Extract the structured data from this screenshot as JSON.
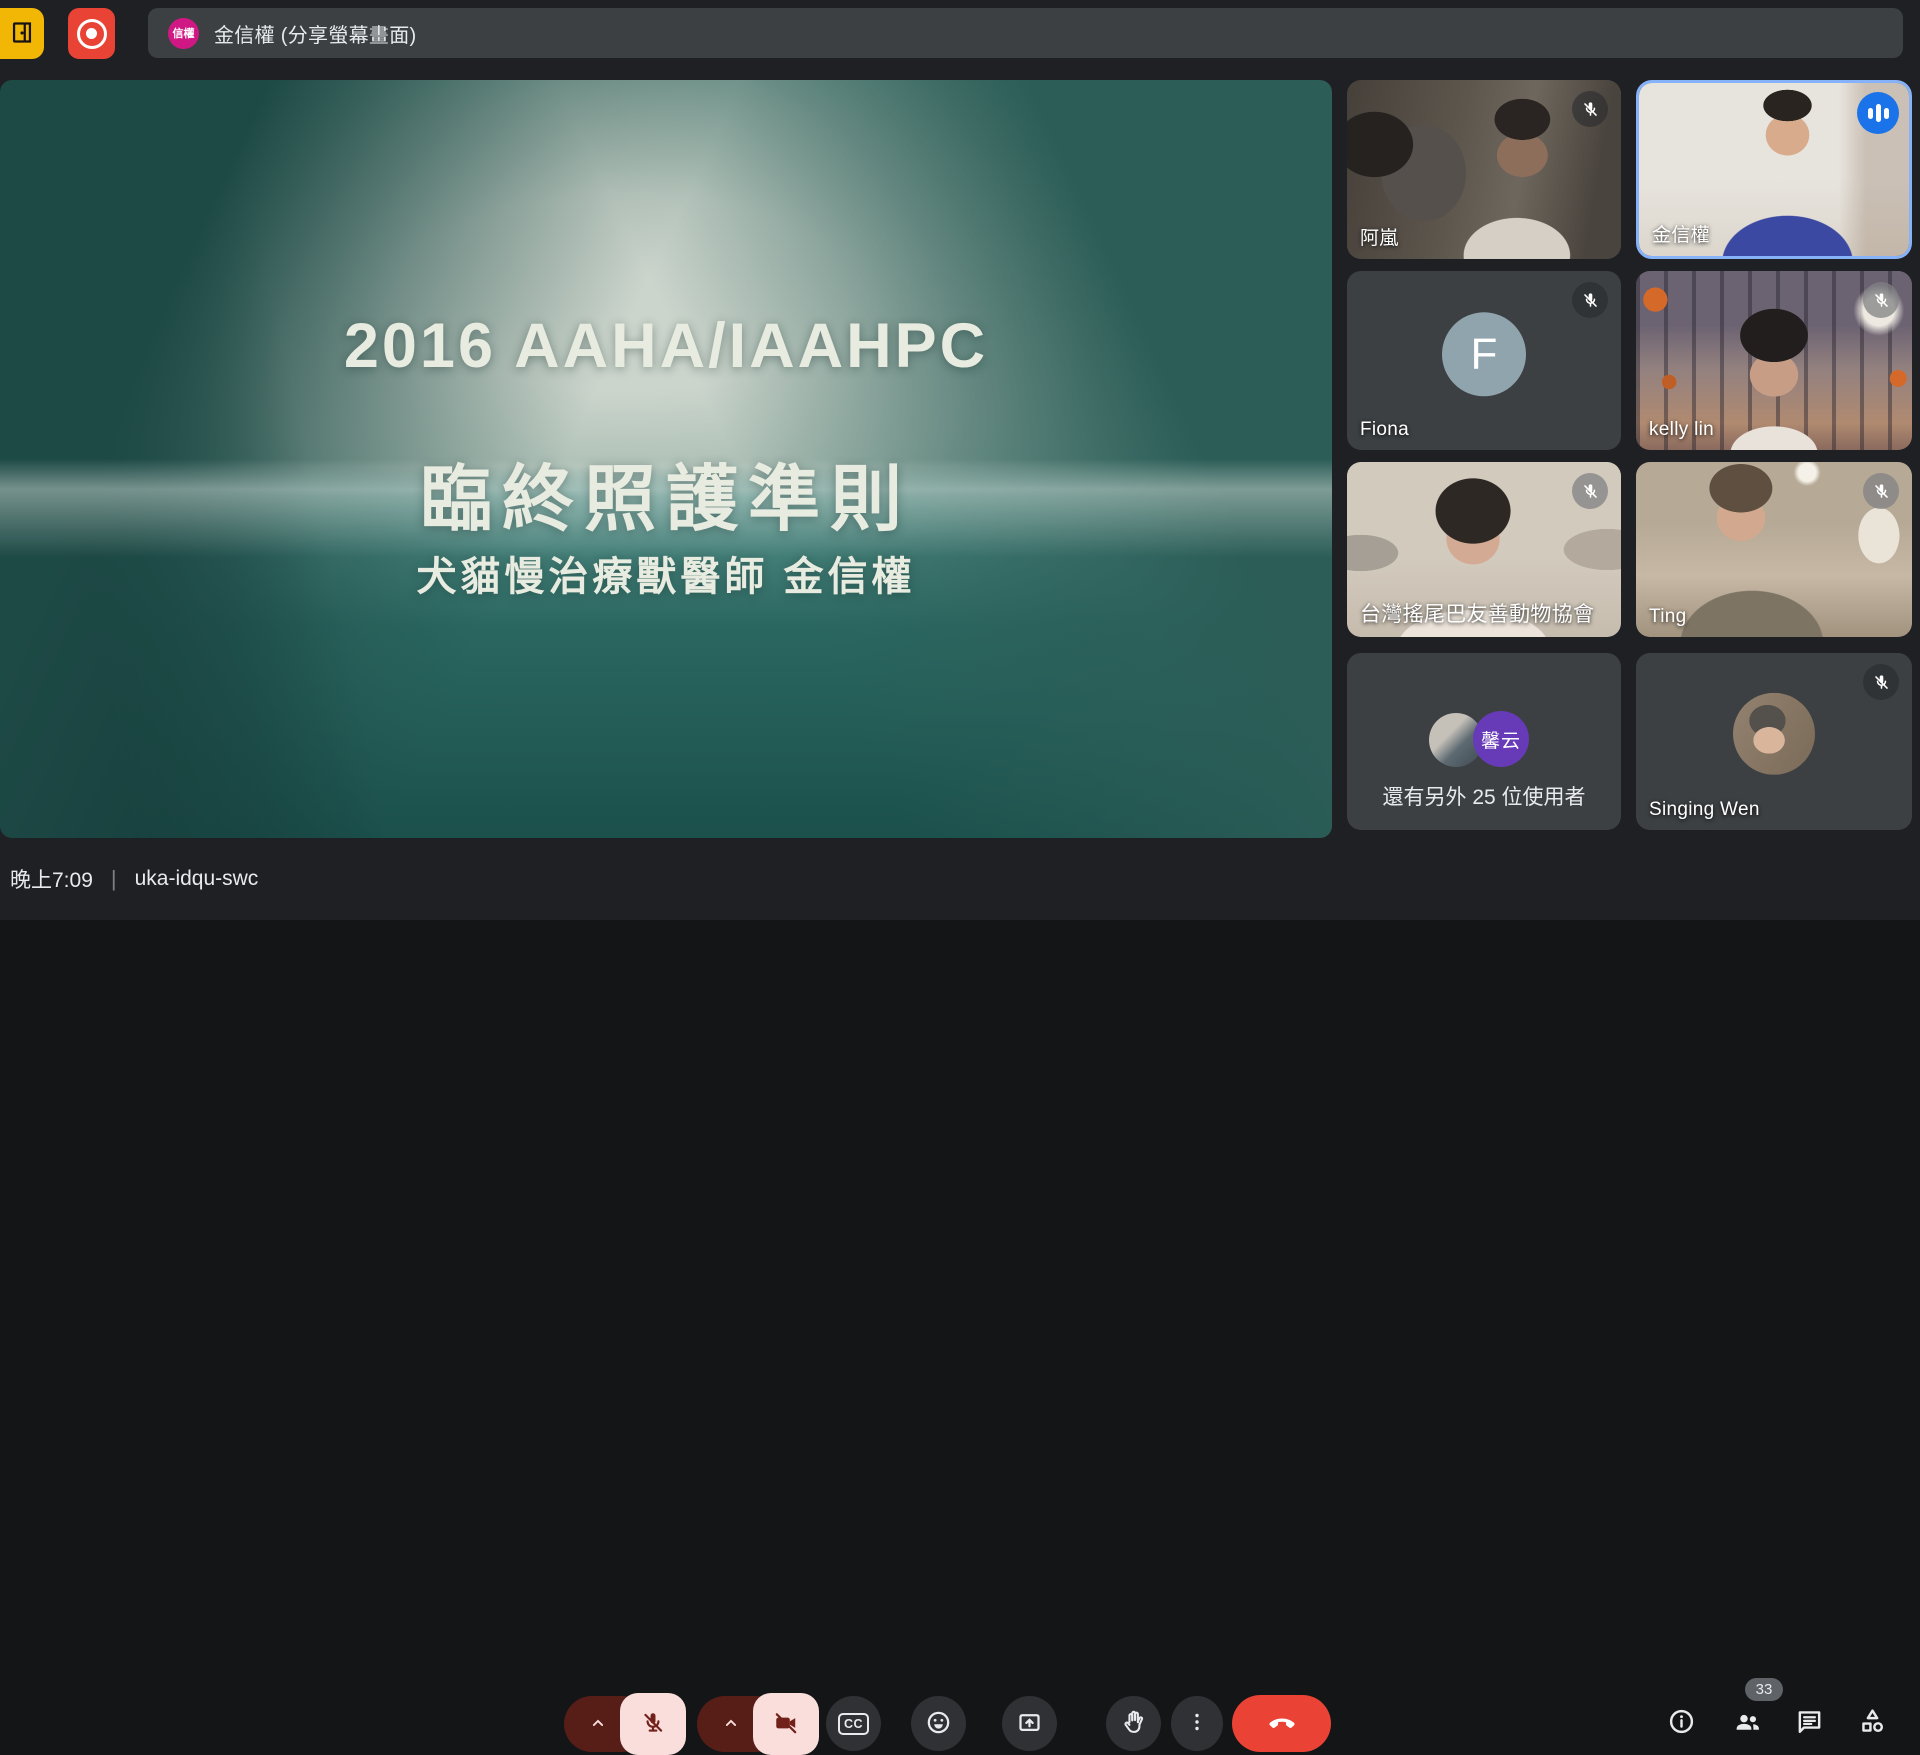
{
  "top_bar": {
    "presenter_chip": {
      "avatar": "信權",
      "title": "金信權 (分享螢幕畫面)"
    }
  },
  "slide": {
    "line1": "2016 AAHA/IAAHPC",
    "line2": "臨終照護準則",
    "line3": "犬貓慢治療獸醫師 金信權"
  },
  "participants": [
    {
      "name": "阿嵐",
      "muted": true
    },
    {
      "name": "金信權",
      "speaking": true
    },
    {
      "name": "Fiona",
      "muted": true,
      "avatar_letter": "F"
    },
    {
      "name": "kelly lin",
      "muted": true
    },
    {
      "name": "台灣搖尾巴友善動物協會",
      "muted": true
    },
    {
      "name": "Ting",
      "muted": true
    },
    {
      "name": "還有另外 25 位使用者",
      "avatar_text": "馨云"
    },
    {
      "name": "Singing Wen",
      "muted": true
    }
  ],
  "bottom_bar": {
    "time": "晚上7:09",
    "meeting_code": "uka-idqu-swc",
    "cc_label": "CC",
    "participant_count": "33"
  },
  "icons": {
    "door-exit-icon": "open door glyph",
    "record-indicator-icon": "ring with dot",
    "mic-off-icon": "microphone with slash",
    "camera-off-icon": "video camera with slash",
    "captions-icon": "CC box",
    "emoji-icon": "smiley face",
    "present-icon": "screen with up arrow",
    "raise-hand-icon": "raised hand",
    "more-options-icon": "three vertical dots",
    "end-call-icon": "phone handset down",
    "info-icon": "circled i",
    "people-icon": "two persons",
    "chat-icon": "speech bubble with lines",
    "activities-icon": "triangle square circle",
    "audio-level-icon": "three sound bars"
  },
  "colors": {
    "accent_blue": "#85b2f9",
    "speaker_badge_blue": "#1a73e8",
    "record_red": "#e94335",
    "end_call_red": "#ea4335",
    "muted_pink": "#f9dedc",
    "muted_dark_red": "#571e18",
    "chip_bg": "#3c4043",
    "presenter_avatar_pink": "#d01884",
    "overflow_avatar_purple": "#673ab7",
    "letter_avatar_gray": "#90a4ae",
    "door_button_yellow": "#f2b705"
  }
}
